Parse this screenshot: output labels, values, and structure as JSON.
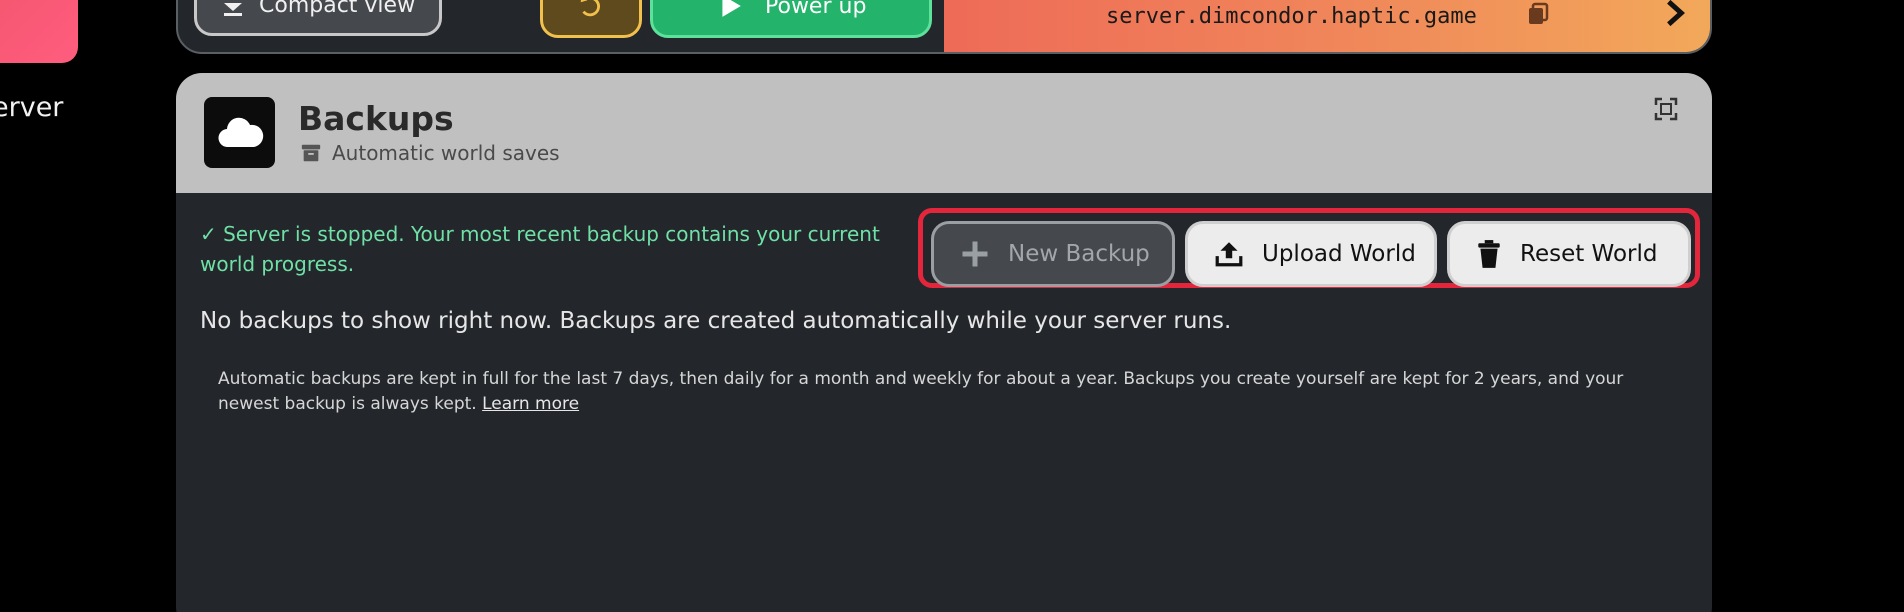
{
  "sidebar": {
    "partial_label": "erver"
  },
  "topbar": {
    "compact_view_label": "Compact view",
    "power_label": "Power up",
    "server_address": "server.dimcondor.haptic.game"
  },
  "card": {
    "title": "Backups",
    "subtitle": "Automatic world saves",
    "status": "✓ Server is stopped. Your most recent backup contains your current world progress.",
    "buttons": {
      "new_backup": "New Backup",
      "upload_world": "Upload World",
      "reset_world": "Reset World"
    },
    "empty_message": "No backups to show right now. Backups are created automatically while your server runs.",
    "retention_note": "Automatic backups are kept in full for the last 7 days, then daily for a month and weekly for about a year. Backups you create yourself are kept for 2 years, and your newest backup is always kept.",
    "learn_more": "Learn more"
  },
  "colors": {
    "status_green": "#6fe0a6",
    "highlight_red": "#e3263b",
    "power_green": "#23b36b",
    "restart_amber": "#f2c04d"
  }
}
